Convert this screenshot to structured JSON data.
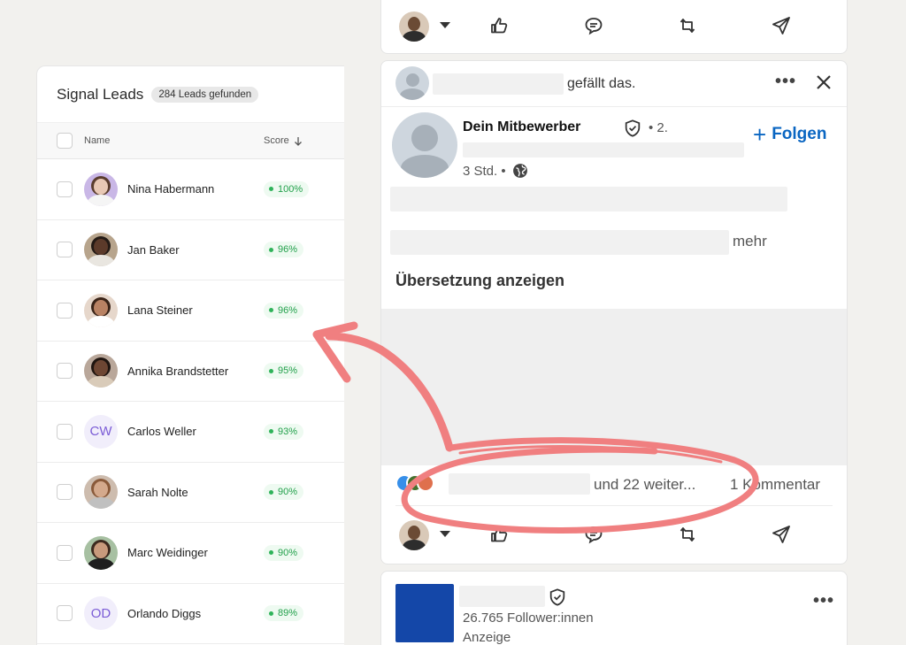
{
  "leads_panel": {
    "title": "Signal Leads",
    "badge": "284 Leads gefunden",
    "columns": {
      "name": "Name",
      "score": "Score"
    },
    "rows": [
      {
        "name": "Nina Habermann",
        "score": "100%",
        "avatar": "photo",
        "skin": "#e8c8b5",
        "hair": "#5a3d2e",
        "shirt": "#f5f5f5",
        "bg": "#c9b7e6"
      },
      {
        "name": "Jan Baker",
        "score": "96%",
        "avatar": "photo",
        "skin": "#5b3a2a",
        "hair": "#231a15",
        "shirt": "#e9e6e0",
        "bg": "#b7a48c"
      },
      {
        "name": "Lana Steiner",
        "score": "96%",
        "avatar": "photo",
        "skin": "#b98263",
        "hair": "#3a2418",
        "shirt": "#ffffff",
        "bg": "#e6d7cb"
      },
      {
        "name": "Annika Brandstetter",
        "score": "95%",
        "avatar": "photo",
        "skin": "#6d4633",
        "hair": "#1f1510",
        "shirt": "#d9cbb9",
        "bg": "#b9a79a"
      },
      {
        "name": "Carlos Weller",
        "score": "93%",
        "avatar": "initials",
        "initials": "CW"
      },
      {
        "name": "Sarah Nolte",
        "score": "90%",
        "avatar": "photo",
        "skin": "#d4a98c",
        "hair": "#8a5a3a",
        "shirt": "#c0c0c0",
        "bg": "#cdbcae"
      },
      {
        "name": "Marc Weidinger",
        "score": "90%",
        "avatar": "photo",
        "skin": "#c89a7c",
        "hair": "#3d2a1f",
        "shirt": "#1f1f1f",
        "bg": "#a7c0a2"
      },
      {
        "name": "Orlando Diggs",
        "score": "89%",
        "avatar": "initials",
        "initials": "OD"
      }
    ]
  },
  "feed": {
    "liker_text": "gefällt das.",
    "author": "Dein Mitbewerber",
    "degree": "• 2.",
    "follow_label": "Folgen",
    "time": "3 Std. •",
    "more_label": "mehr",
    "translate_label": "Übersetzung anzeigen",
    "reactions_text": "und 22 weiter...",
    "comments_text": "1 Kommentar",
    "company_followers": "26.765 Follower:innen",
    "ad_label": "Anzeige"
  },
  "colors": {
    "linkedin_blue": "#0a66c2",
    "score_green": "#22a04b",
    "annotation_pink": "#f07f80",
    "company_logo": "#1447a8"
  }
}
